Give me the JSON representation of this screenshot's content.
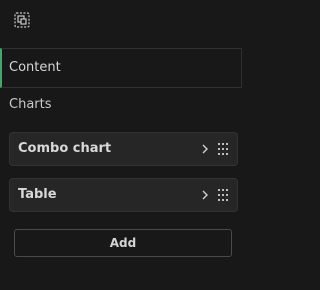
{
  "toolbar": {
    "icon": "layers-icon"
  },
  "section": {
    "title": "Content"
  },
  "charts": {
    "heading": "Charts",
    "items": [
      {
        "label": "Combo chart",
        "icons": [
          "chevron-right-icon",
          "drag-handle-icon"
        ]
      },
      {
        "label": "Table",
        "icons": [
          "chevron-right-icon",
          "drag-handle-icon"
        ]
      }
    ],
    "add_label": "Add"
  },
  "colors": {
    "background": "#181818",
    "accent": "#3fa86a",
    "item_background": "#262626",
    "border": "#303030"
  }
}
